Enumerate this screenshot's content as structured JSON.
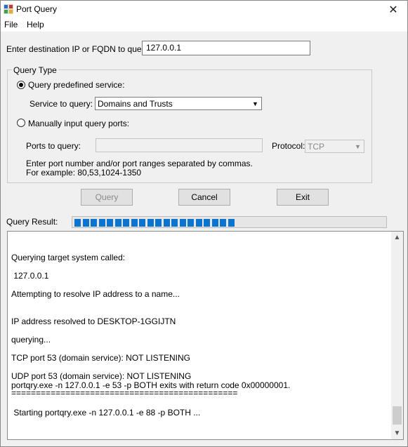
{
  "window": {
    "title": "Port Query",
    "close_label": "✕"
  },
  "menu": {
    "items": [
      "File",
      "Help"
    ]
  },
  "destination": {
    "label": "Enter destination IP or FQDN to query:",
    "value": "127.0.0.1"
  },
  "query_type": {
    "group_label": "Query Type",
    "predefined_label": "Query predefined service:",
    "predefined_selected": true,
    "service_label": "Service to query:",
    "service_value": "Domains and Trusts",
    "manual_label": "Manually input query ports:",
    "ports_label": "Ports to query:",
    "ports_value": "",
    "protocol_label": "Protocol:",
    "protocol_value": "TCP",
    "hint_line1": "Enter port number and/or port ranges separated by commas.",
    "hint_line2": "For example: 80,53,1024-1350"
  },
  "buttons": {
    "query": "Query",
    "cancel": "Cancel",
    "exit": "Exit"
  },
  "result": {
    "label": "Query Result:",
    "progress_segments": 20,
    "accent_color": "#0a74d0",
    "lines": [
      "Querying target system called:",
      " 127.0.0.1",
      "Attempting to resolve IP address to a name...",
      "IP address resolved to DESKTOP-1GGIJTN",
      "querying...",
      "TCP port 53 (domain service): NOT LISTENING",
      "UDP port 53 (domain service): NOT LISTENING",
      "portqry.exe -n 127.0.0.1 -e 53 -p BOTH exits with return code 0x00000001.",
      "==============================================",
      " Starting portqry.exe -n 127.0.0.1 -e 88 -p BOTH ..."
    ]
  },
  "icons": {
    "app": "port-query-app-icon",
    "scroll_up": "▲",
    "scroll_down": "▼",
    "dropdown": "▼"
  }
}
